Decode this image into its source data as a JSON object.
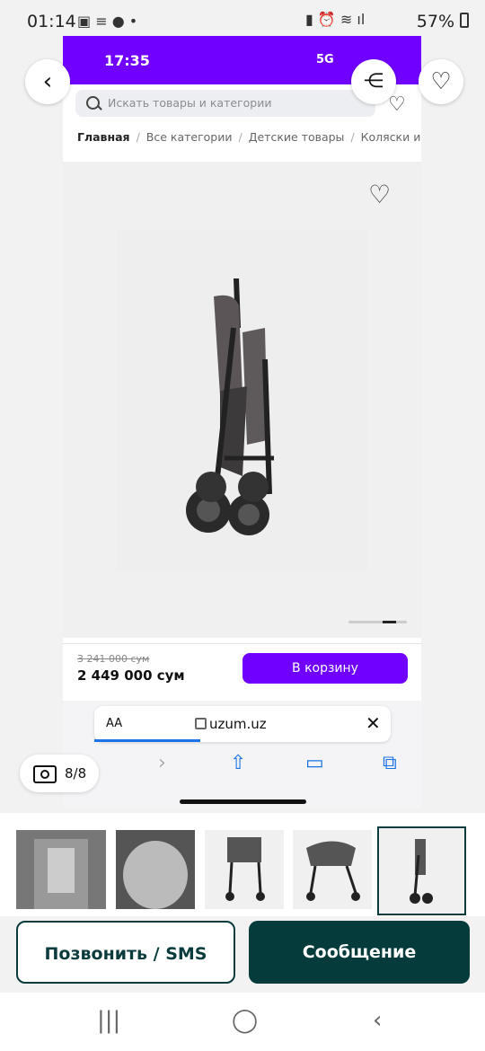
{
  "status_bar": {
    "time": "01:14",
    "battery": "57%"
  },
  "inner": {
    "ios_time": "17:35",
    "network": "5G",
    "search_placeholder": "Искать товары и категории",
    "breadcrumbs": [
      "Главная",
      "Все категории",
      "Детские товары",
      "Коляски и"
    ],
    "old_price": "3 241 000 сум",
    "price": "2 449 000 сум",
    "cart_button": "В корзину",
    "url_aa": "AA",
    "url": "uzum.uz"
  },
  "gallery": {
    "counter": "8/8",
    "thumbnail_count": 5,
    "selected_index": 4
  },
  "actions": {
    "call": "Позвонить / SMS",
    "message": "Сообщение"
  },
  "icons": [
    "back-arrow-icon",
    "share-icon",
    "heart-icon",
    "camera-icon",
    "search-icon",
    "lock-icon",
    "close-icon",
    "share-up-icon",
    "book-icon",
    "tabs-icon"
  ]
}
